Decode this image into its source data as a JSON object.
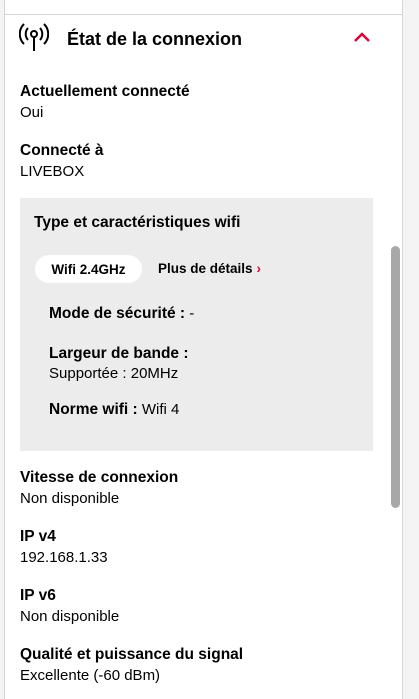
{
  "section": {
    "title": "État de la connexion",
    "icon": "wifi-signal-icon",
    "collapse_icon": "chevron-up-icon",
    "accent_color": "#e0003c"
  },
  "fields_top": [
    {
      "label": "Actuellement connecté",
      "value": "Oui"
    },
    {
      "label": "Connecté à",
      "value": "LIVEBOX"
    }
  ],
  "wifi": {
    "title": "Type et caractéristiques wifi",
    "band": "Wifi 2.4GHz",
    "details_link": "Plus de détails",
    "security_label": "Mode de sécurité :",
    "security_value": "-",
    "bandwidth_label": "Largeur de bande :",
    "bandwidth_value": "Supportée : 20MHz",
    "norm_label": "Norme wifi :",
    "norm_value": "Wifi 4"
  },
  "fields_bottom": [
    {
      "label": "Vitesse de connexion",
      "value": "Non disponible"
    },
    {
      "label": "IP v4",
      "value": "192.168.1.33"
    },
    {
      "label": "IP v6",
      "value": "Non disponible"
    },
    {
      "label": "Qualité et puissance du signal",
      "value": "Excellente (-60 dBm)"
    }
  ]
}
